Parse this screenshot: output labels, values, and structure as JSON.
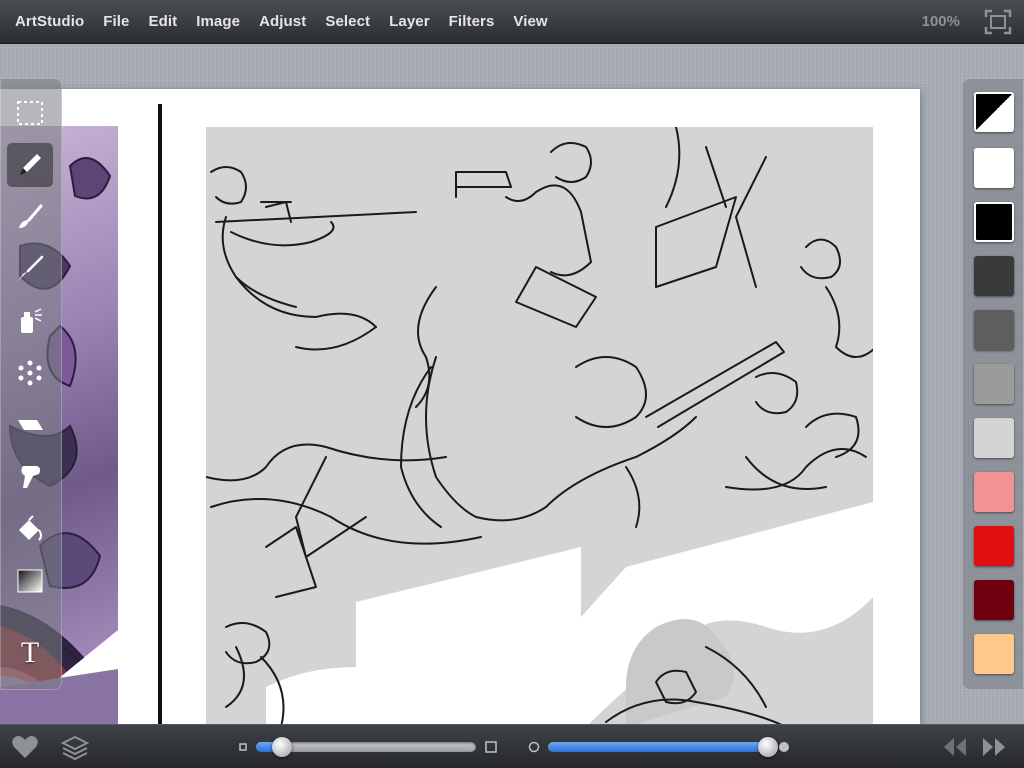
{
  "app": {
    "name": "ArtStudio"
  },
  "menu": {
    "items": [
      "File",
      "Edit",
      "Image",
      "Adjust",
      "Select",
      "Layer",
      "Filters",
      "View"
    ]
  },
  "status": {
    "zoom": "100%"
  },
  "tools": [
    {
      "name": "marquee-select-tool",
      "icon": "dashed-rectangle-icon"
    },
    {
      "name": "pencil-tool",
      "icon": "pencil-icon",
      "selected": true
    },
    {
      "name": "brush-tool",
      "icon": "brush-icon"
    },
    {
      "name": "fine-brush-tool",
      "icon": "fine-brush-icon"
    },
    {
      "name": "spray-tool",
      "icon": "spray-can-icon"
    },
    {
      "name": "particle-brush-tool",
      "icon": "dots-icon"
    },
    {
      "name": "eraser-tool",
      "icon": "eraser-icon"
    },
    {
      "name": "smudge-tool",
      "icon": "smudge-finger-icon"
    },
    {
      "name": "fill-tool",
      "icon": "paint-bucket-icon"
    },
    {
      "name": "gradient-tool",
      "icon": "gradient-icon"
    },
    {
      "name": "text-tool",
      "icon": "text-icon",
      "label": "T"
    }
  ],
  "palette": {
    "swatches": [
      {
        "name": "primary-secondary",
        "color": "split-black-white"
      },
      {
        "name": "white",
        "color": "#ffffff"
      },
      {
        "name": "black",
        "color": "#000000",
        "current": true
      },
      {
        "name": "dark-gray",
        "color": "#3a3a3a"
      },
      {
        "name": "medium-dark-gray",
        "color": "#5e5e5e"
      },
      {
        "name": "gray",
        "color": "#9b9b9b"
      },
      {
        "name": "light-gray",
        "color": "#d4d4d4"
      },
      {
        "name": "salmon",
        "color": "#f29393"
      },
      {
        "name": "red",
        "color": "#e01010"
      },
      {
        "name": "dark-red",
        "color": "#6e0010"
      },
      {
        "name": "peach",
        "color": "#ffc98a"
      }
    ]
  },
  "bottom": {
    "size_slider_value": 0.12,
    "opacity_slider_value": 1.0
  },
  "colors": {
    "accent_blue": "#2a6fd8",
    "panel_gray": "#d4d4d4"
  }
}
